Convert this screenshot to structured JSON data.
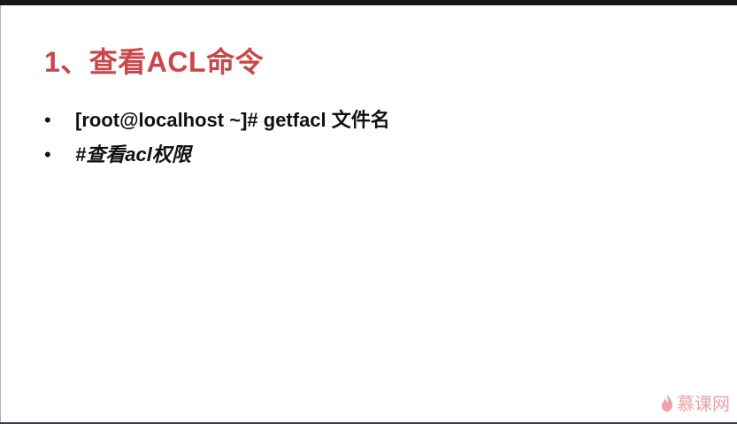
{
  "slide": {
    "title": "1、查看ACL命令",
    "bullets": [
      {
        "text": "[root@localhost ~]# getfacl 文件名",
        "italic": false
      },
      {
        "text": "#查看acl权限",
        "italic": true
      }
    ],
    "bullet_glyph": "•"
  },
  "watermark": {
    "text": "慕课网",
    "icon": "flame-icon"
  },
  "colors": {
    "title": "#c9474a",
    "watermark": "#eba3a5"
  }
}
